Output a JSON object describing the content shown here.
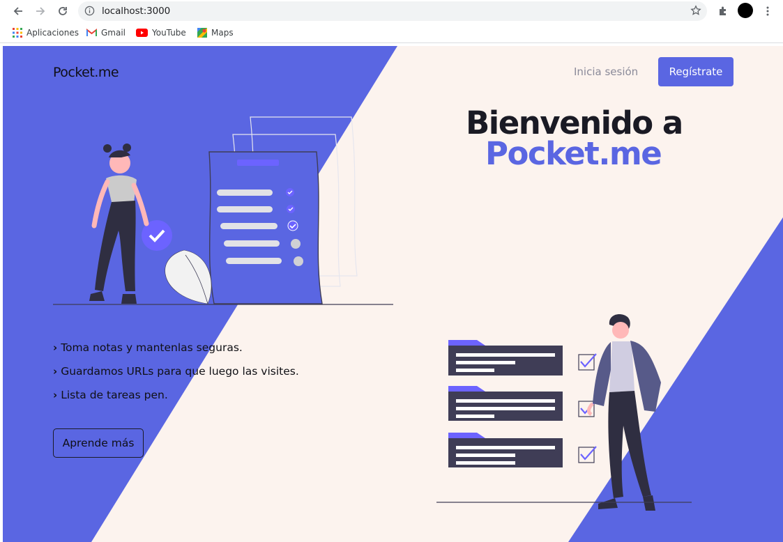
{
  "browser": {
    "url": "localhost:3000",
    "bookmarks": [
      {
        "label": "Aplicaciones",
        "icon": "apps-grid-icon"
      },
      {
        "label": "Gmail",
        "icon": "gmail-icon"
      },
      {
        "label": "YouTube",
        "icon": "youtube-icon"
      },
      {
        "label": "Maps",
        "icon": "maps-icon"
      }
    ]
  },
  "header": {
    "brand": "Pocket.me",
    "login_label": "Inicia sesión",
    "register_label": "Regístrate"
  },
  "hero": {
    "title_line1": "Bienvenido a",
    "title_line2": "Pocket.me"
  },
  "features": [
    "Toma notas y mantenlas seguras.",
    "Guardamos URLs para que luego las visites.",
    "Lista de tareas pen."
  ],
  "cta": {
    "learn_more_label": "Aprende más"
  },
  "colors": {
    "accent": "#5a66e2",
    "background": "#fcf3ee",
    "dark": "#3f3d56"
  }
}
